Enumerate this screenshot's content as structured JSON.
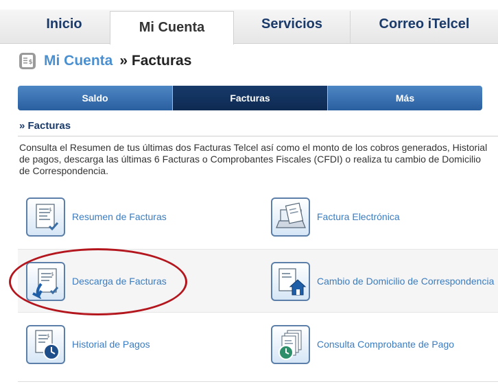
{
  "topnav": {
    "tabs": [
      {
        "label": "Inicio"
      },
      {
        "label": "Mi Cuenta"
      },
      {
        "label": "Servicios"
      },
      {
        "label": "Correo iTelcel"
      }
    ]
  },
  "breadcrumb": {
    "root": "Mi Cuenta",
    "separator": "»",
    "current": "Facturas"
  },
  "subnav": {
    "items": [
      {
        "label": "Saldo"
      },
      {
        "label": "Facturas"
      },
      {
        "label": "Más"
      }
    ]
  },
  "section": {
    "title": "» Facturas"
  },
  "description": "Consulta el Resumen de tus últimas dos Facturas Telcel así como el monto de los cobros generados, Historial de pagos, descarga las últimas 6 Facturas o Comprobantes Fiscales (CFDI) o realiza tu cambio de Domicilio de Correspondencia.",
  "options": [
    {
      "label": "Resumen de Facturas",
      "icon": "invoice-check-icon"
    },
    {
      "label": "Factura Electrónica",
      "icon": "laptop-invoice-icon"
    },
    {
      "label": "Descarga de Facturas",
      "icon": "invoice-download-icon"
    },
    {
      "label": "Cambio de Domicilio de Correspondencia",
      "icon": "invoice-house-icon"
    },
    {
      "label": "Historial de Pagos",
      "icon": "invoice-clock-icon"
    },
    {
      "label": "Consulta Comprobante de Pago",
      "icon": "receipt-history-icon"
    }
  ],
  "colors": {
    "accent": "#2a5f9f",
    "active_subnav": "#0e2a52",
    "link": "#3a7cc0",
    "highlight": "#b4161e"
  }
}
